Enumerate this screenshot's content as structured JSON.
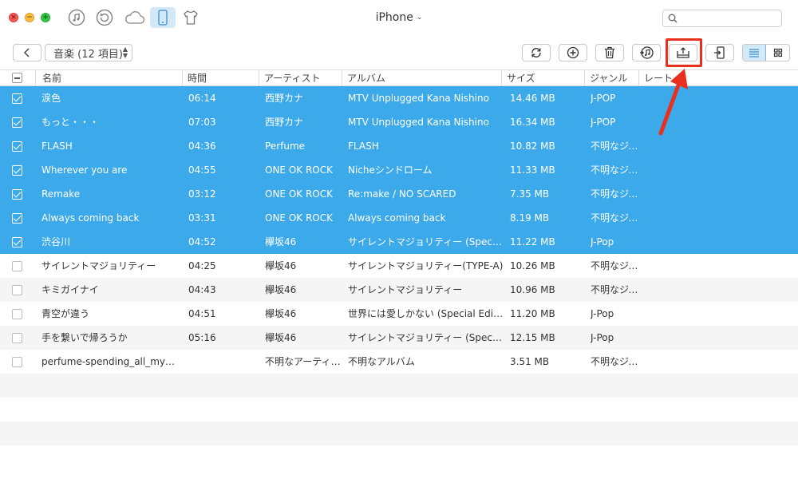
{
  "window": {
    "device_title": "iPhone",
    "search": {
      "placeholder": "",
      "value": ""
    }
  },
  "top_icons": [
    "music-icon",
    "history-icon",
    "cloud-icon",
    "iphone-icon",
    "shirt-icon"
  ],
  "toolbar": {
    "category_label": "音楽 (12 項目)",
    "actions": [
      "refresh-icon",
      "add-icon",
      "trash-icon",
      "itunes-icon",
      "export-to-computer-icon",
      "export-to-device-icon"
    ],
    "view_modes": [
      "list-view-icon",
      "grid-view-icon"
    ]
  },
  "table": {
    "headers": {
      "name": "名前",
      "time": "時間",
      "artist": "アーティスト",
      "album": "アルバム",
      "size": "サイズ",
      "genre": "ジャンル",
      "rating": "レート"
    },
    "rows": [
      {
        "name": "涙色",
        "time": "06:14",
        "artist": "西野カナ",
        "album": "MTV Unplugged Kana Nishino",
        "size": "14.46 MB",
        "genre": "J-POP",
        "selected": true
      },
      {
        "name": "もっと・・・",
        "time": "07:03",
        "artist": "西野カナ",
        "album": "MTV Unplugged Kana Nishino",
        "size": "16.34 MB",
        "genre": "J-POP",
        "selected": true
      },
      {
        "name": "FLASH",
        "time": "04:36",
        "artist": "Perfume",
        "album": "FLASH",
        "size": "10.82 MB",
        "genre": "不明なジャンル",
        "selected": true
      },
      {
        "name": "Wherever you are",
        "time": "04:55",
        "artist": "ONE OK ROCK",
        "album": "Nicheシンドローム",
        "size": "11.33 MB",
        "genre": "不明なジャンル",
        "selected": true
      },
      {
        "name": "Remake",
        "time": "03:12",
        "artist": "ONE OK ROCK",
        "album": "Re:make / NO SCARED",
        "size": "7.35 MB",
        "genre": "不明なジャンル",
        "selected": true
      },
      {
        "name": "Always coming back",
        "time": "03:31",
        "artist": "ONE OK ROCK",
        "album": "Always coming back",
        "size": "8.19 MB",
        "genre": "不明なジャンル",
        "selected": true
      },
      {
        "name": "渋谷川",
        "time": "04:52",
        "artist": "欅坂46",
        "album": "サイレントマジョリティー (Special Edition)",
        "size": "11.22 MB",
        "genre": "J-Pop",
        "selected": true
      },
      {
        "name": "サイレントマジョリティー",
        "time": "04:25",
        "artist": "欅坂46",
        "album": "サイレントマジョリティー(TYPE-A)",
        "size": "10.26 MB",
        "genre": "不明なジャンル",
        "selected": false
      },
      {
        "name": "キミガイナイ",
        "time": "04:43",
        "artist": "欅坂46",
        "album": "サイレントマジョリティー",
        "size": "10.96 MB",
        "genre": "不明なジャンル",
        "selected": false
      },
      {
        "name": "青空が違う",
        "time": "04:51",
        "artist": "欅坂46",
        "album": "世界には愛しかない (Special Edition)",
        "size": "11.20 MB",
        "genre": "J-Pop",
        "selected": false
      },
      {
        "name": "手を繋いで帰ろうか",
        "time": "05:16",
        "artist": "欅坂46",
        "album": "サイレントマジョリティー (Special Edition)",
        "size": "12.15 MB",
        "genre": "J-Pop",
        "selected": false
      },
      {
        "name": "perfume-spending_all_my_time",
        "time": "",
        "artist": "不明なアーティスト",
        "album": "不明なアルバム",
        "size": "3.51 MB",
        "genre": "不明なジャンル",
        "selected": false
      }
    ],
    "empty_rows": 4
  },
  "colors": {
    "selection": "#3ca9ea",
    "highlight_box": "#e8301c",
    "active_icon_bg": "#d4e9f7"
  }
}
